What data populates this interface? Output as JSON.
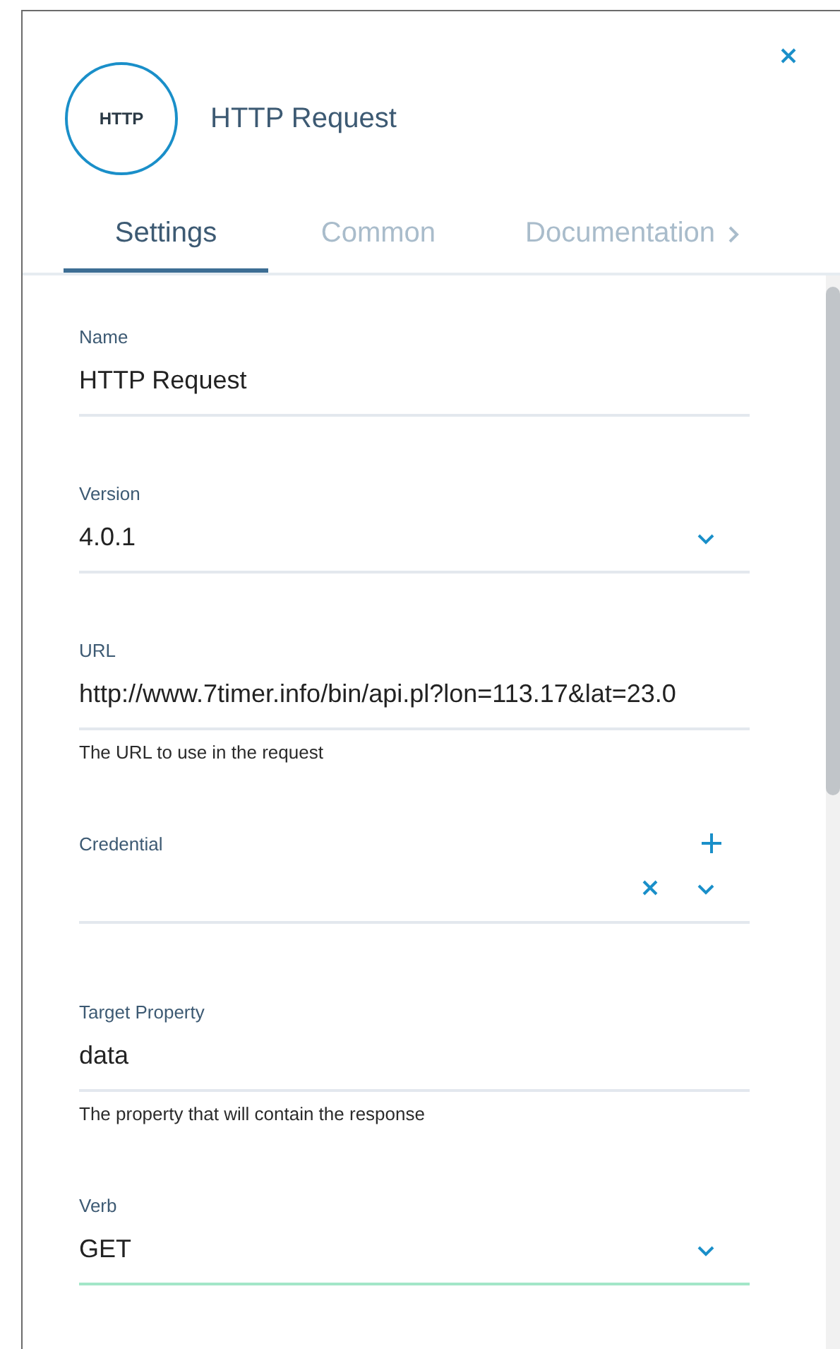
{
  "header": {
    "icon_text": "HTTP",
    "title": "HTTP Request"
  },
  "tabs": [
    {
      "label": "Settings",
      "selected": true
    },
    {
      "label": "Common",
      "selected": false
    },
    {
      "label": "Documentation",
      "selected": false,
      "more": true
    }
  ],
  "fields": [
    {
      "kind": "text",
      "label": "Name",
      "value": "HTTP Request",
      "focused": false
    },
    {
      "kind": "select",
      "label": "Version",
      "value": "4.0.1",
      "focused": false
    },
    {
      "kind": "text",
      "label": "URL",
      "value": "http://www.7timer.info/bin/api.pl?lon=113.17&lat=23.0",
      "hint": "The URL to use in the request",
      "focused": false
    },
    {
      "kind": "credential",
      "label": "Credential",
      "focused": false
    },
    {
      "kind": "text",
      "label": "Target Property",
      "value": "data",
      "hint": "The property that will contain the response",
      "focused": false
    },
    {
      "kind": "select",
      "label": "Verb",
      "value": "GET",
      "focused": true
    }
  ]
}
